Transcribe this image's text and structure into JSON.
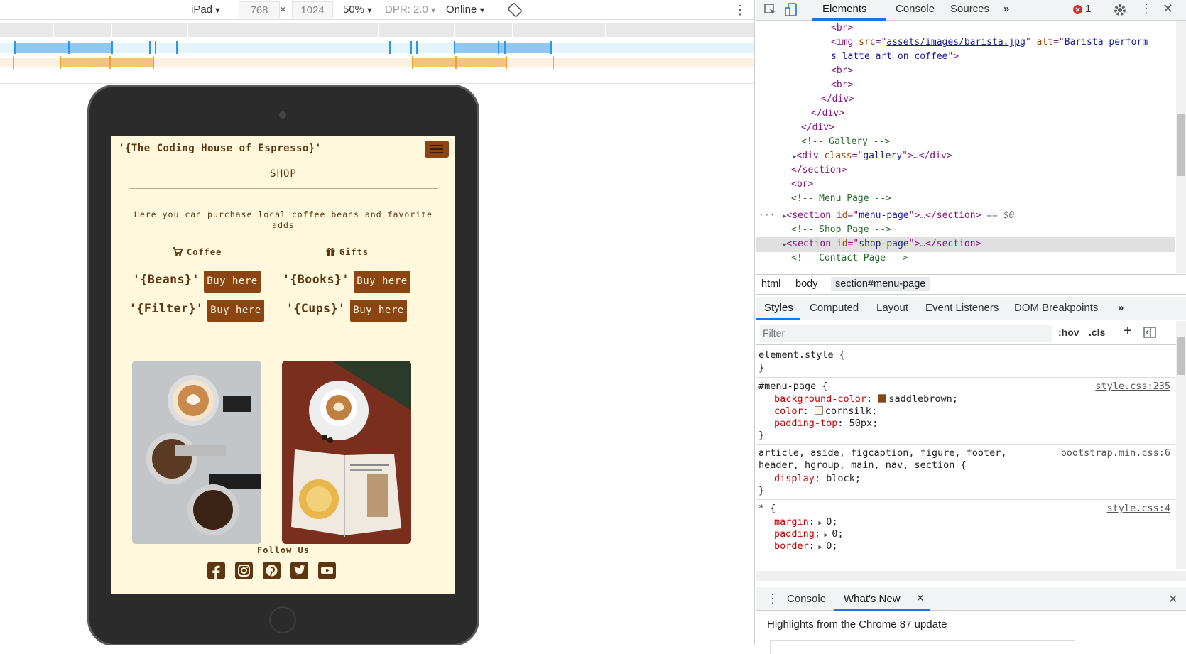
{
  "device_toolbar": {
    "device": "iPad",
    "width": "768",
    "times": "×",
    "height": "1024",
    "zoom": "50%",
    "dpr": "DPR: 2.0",
    "network": "Online"
  },
  "site": {
    "brand": "'{The Coding House of Espresso}'",
    "section_title": "SHOP",
    "intro": "Here you can purchase local coffee beans and favorite adds",
    "categories": [
      {
        "label": "Coffee",
        "icon": "cart-icon"
      },
      {
        "label": "Gifts",
        "icon": "gift-icon"
      }
    ],
    "products": [
      {
        "name": "'{Beans}'",
        "button": "Buy here"
      },
      {
        "name": "'{Filter}'",
        "button": "Buy here"
      },
      {
        "name": "'{Books}'",
        "button": "Buy here"
      },
      {
        "name": "'{Cups}'",
        "button": "Buy here"
      }
    ],
    "follow": "Follow Us",
    "social_icons": [
      "facebook-icon",
      "instagram-icon",
      "pinterest-icon",
      "twitter-icon",
      "youtube-icon"
    ],
    "colors": {
      "background": "#fff8dc",
      "accent": "#8b4513",
      "text": "#5d3611"
    }
  },
  "devtools": {
    "tabs": [
      "Elements",
      "Console",
      "Sources"
    ],
    "more": "»",
    "error_count": "1",
    "dom_lines": [
      {
        "tag_open": "<br>"
      },
      {
        "img_src": "assets/images/barista.jpg",
        "img_alt_1": "Barista perform",
        "img_alt_2": "s latte art on coffee"
      },
      {
        "tag": "<br>"
      },
      {
        "tag": "<br>"
      },
      {
        "tag": "</div>"
      },
      {
        "tag": "</div>"
      },
      {
        "tag": "</div>"
      },
      {
        "comment": "<!-- Gallery -->"
      },
      {
        "div_class": "gallery"
      },
      {
        "tag": "</section>"
      },
      {
        "tag": "<br>"
      },
      {
        "comment": "<!-- Menu Page -->"
      },
      {
        "section_id": "menu-page",
        "dollar": "== $0"
      },
      {
        "comment": "<!-- Shop Page -->"
      },
      {
        "section_id": "shop-page"
      },
      {
        "comment": "<!-- Contact Page -->"
      }
    ],
    "breadcrumbs": [
      "html",
      "body",
      "section#menu-page"
    ],
    "sub_tabs": [
      "Styles",
      "Computed",
      "Layout",
      "Event Listeners",
      "DOM Breakpoints"
    ],
    "filter_placeholder": "Filter",
    "hov": ":hov",
    "cls": ".cls",
    "rules": {
      "element_style": "element.style {",
      "menu_selector": "#menu-page {",
      "menu_source": "style.css:235",
      "menu_props": [
        {
          "name": "background-color",
          "value": "saddlebrown",
          "swatch": "#8b4513"
        },
        {
          "name": "color",
          "value": "cornsilk",
          "swatch": "#fff8dc"
        },
        {
          "name": "padding-top",
          "value": "50px"
        }
      ],
      "bs_selector_1": "article, aside, figcaption, figure, footer,",
      "bs_selector_2": "header, hgroup, main, nav, section {",
      "bs_source": "bootstrap.min.css:6",
      "bs_prop": {
        "name": "display",
        "value": "block"
      },
      "star_selector": "* {",
      "star_source": "style.css:4",
      "star_props": [
        {
          "name": "margin",
          "value": "0"
        },
        {
          "name": "padding",
          "value": "0"
        },
        {
          "name": "border",
          "value": "0"
        }
      ]
    },
    "drawer": {
      "tabs": [
        "Console",
        "What's New"
      ],
      "headline": "Highlights from the Chrome 87 update"
    }
  }
}
